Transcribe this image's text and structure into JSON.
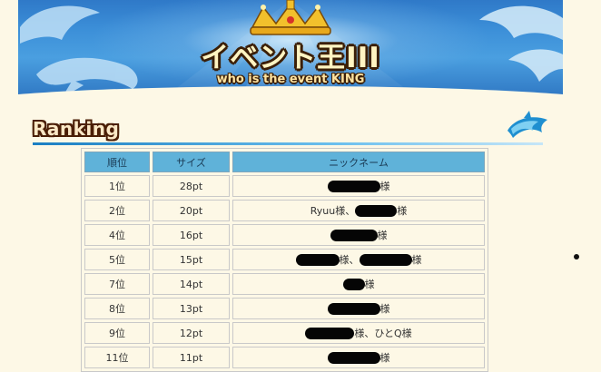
{
  "banner": {
    "title": "イベント王III",
    "subtitle": "who is the event KING"
  },
  "section": {
    "heading": "Ranking"
  },
  "table": {
    "headers": [
      "順位",
      "サイズ",
      "ニックネーム"
    ],
    "rows": [
      {
        "rank": "1位",
        "size": "28pt",
        "name_suffix": "様"
      },
      {
        "rank": "2位",
        "size": "20pt",
        "name_prefix": "Ryuu様、",
        "name_suffix": "様"
      },
      {
        "rank": "4位",
        "size": "16pt",
        "name_suffix": "様"
      },
      {
        "rank": "5位",
        "size": "15pt",
        "name_mid": "様、",
        "name_suffix": "様"
      },
      {
        "rank": "7位",
        "size": "14pt",
        "name_suffix": "様"
      },
      {
        "rank": "8位",
        "size": "13pt",
        "name_suffix": "様"
      },
      {
        "rank": "9位",
        "size": "12pt",
        "name_suffix": "様、ひとQ様"
      },
      {
        "rank": "11位",
        "size": "11pt",
        "name_suffix": "様"
      }
    ]
  },
  "colors": {
    "background": "#fdf8e6",
    "header_cell": "#5fb2d9",
    "banner_sea": "#3c8fd8",
    "heading_brown": "#4a1e06"
  }
}
